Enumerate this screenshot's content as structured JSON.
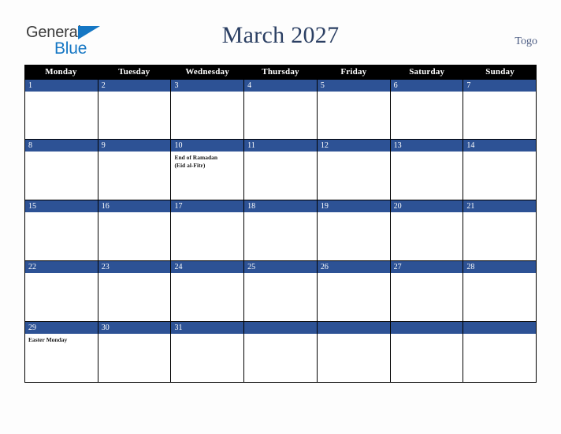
{
  "brand": {
    "name_part1": "General",
    "name_part2": "Blue",
    "triangle_icon": "triangle-icon",
    "color_dark": "#3b3b3b",
    "color_blue": "#1577c4"
  },
  "header": {
    "title": "March 2027",
    "region": "Togo",
    "title_color": "#2b3f63"
  },
  "calendar": {
    "weekday_headers": [
      "Monday",
      "Tuesday",
      "Wednesday",
      "Thursday",
      "Friday",
      "Saturday",
      "Sunday"
    ],
    "header_bg": "#000000",
    "day_band_bg": "#2d5295",
    "cell_bg": "#ffffff",
    "weeks": [
      {
        "days": [
          {
            "num": "1",
            "events": []
          },
          {
            "num": "2",
            "events": []
          },
          {
            "num": "3",
            "events": []
          },
          {
            "num": "4",
            "events": []
          },
          {
            "num": "5",
            "events": []
          },
          {
            "num": "6",
            "events": []
          },
          {
            "num": "7",
            "events": []
          }
        ]
      },
      {
        "days": [
          {
            "num": "8",
            "events": []
          },
          {
            "num": "9",
            "events": []
          },
          {
            "num": "10",
            "events": [
              "End of Ramadan",
              "(Eid al-Fitr)"
            ]
          },
          {
            "num": "11",
            "events": []
          },
          {
            "num": "12",
            "events": []
          },
          {
            "num": "13",
            "events": []
          },
          {
            "num": "14",
            "events": []
          }
        ]
      },
      {
        "days": [
          {
            "num": "15",
            "events": []
          },
          {
            "num": "16",
            "events": []
          },
          {
            "num": "17",
            "events": []
          },
          {
            "num": "18",
            "events": []
          },
          {
            "num": "19",
            "events": []
          },
          {
            "num": "20",
            "events": []
          },
          {
            "num": "21",
            "events": []
          }
        ]
      },
      {
        "days": [
          {
            "num": "22",
            "events": []
          },
          {
            "num": "23",
            "events": []
          },
          {
            "num": "24",
            "events": []
          },
          {
            "num": "25",
            "events": []
          },
          {
            "num": "26",
            "events": []
          },
          {
            "num": "27",
            "events": []
          },
          {
            "num": "28",
            "events": []
          }
        ]
      },
      {
        "days": [
          {
            "num": "29",
            "events": [
              "Easter Monday"
            ]
          },
          {
            "num": "30",
            "events": []
          },
          {
            "num": "31",
            "events": []
          },
          {
            "num": "",
            "events": []
          },
          {
            "num": "",
            "events": []
          },
          {
            "num": "",
            "events": []
          },
          {
            "num": "",
            "events": []
          }
        ]
      }
    ]
  }
}
